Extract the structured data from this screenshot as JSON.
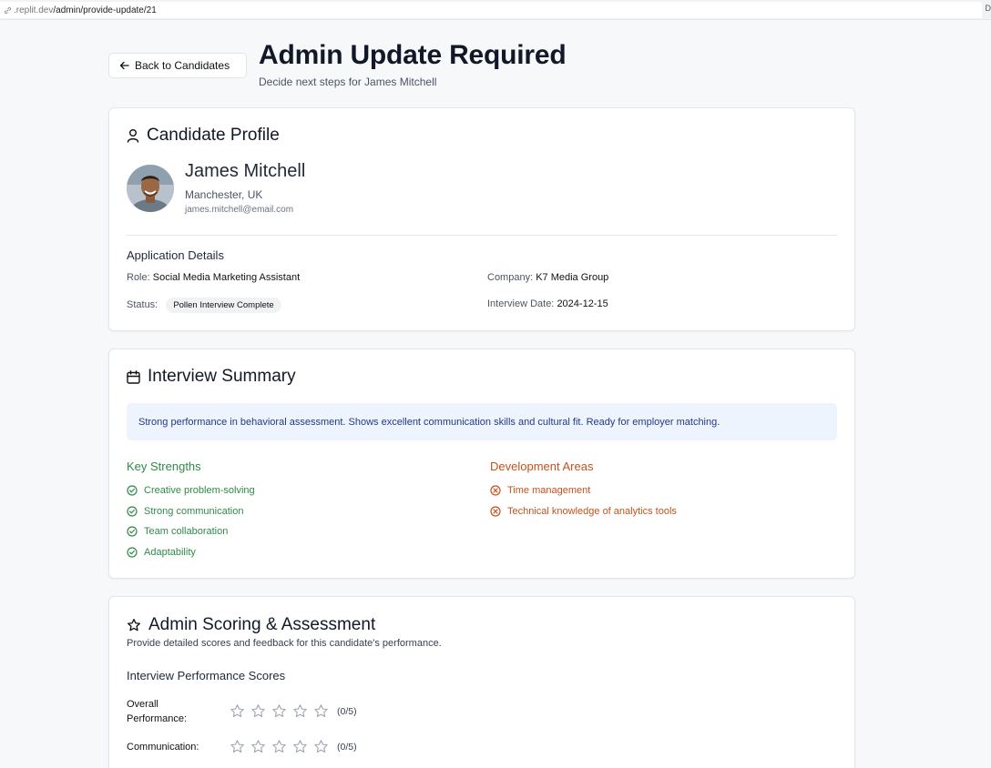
{
  "browser": {
    "url_host": ".replit.dev",
    "url_path": "/admin/provide-update/21",
    "edge_char": "D"
  },
  "header": {
    "back_label": "Back to Candidates",
    "title": "Admin Update Required",
    "subtitle": "Decide next steps for James Mitchell"
  },
  "profile": {
    "title": "Candidate Profile",
    "name": "James Mitchell",
    "location": "Manchester, UK",
    "email": "james.mitchell@email.com",
    "details_heading": "Application Details",
    "role_label": "Role:",
    "role": "Social Media Marketing Assistant",
    "company_label": "Company:",
    "company": "K7 Media Group",
    "status_label": "Status:",
    "status": "Pollen Interview Complete",
    "interview_date_label": "Interview Date:",
    "interview_date": "2024-12-15"
  },
  "summary": {
    "title": "Interview Summary",
    "text": "Strong performance in behavioral assessment. Shows excellent communication skills and cultural fit. Ready for employer matching.",
    "strengths_heading": "Key Strengths",
    "strengths": [
      "Creative problem-solving",
      "Strong communication",
      "Team collaboration",
      "Adaptability"
    ],
    "development_heading": "Development Areas",
    "development": [
      "Time management",
      "Technical knowledge of analytics tools"
    ]
  },
  "scoring": {
    "title": "Admin Scoring & Assessment",
    "subtitle": "Provide detailed scores and feedback for this candidate's performance.",
    "scores_heading": "Interview Performance Scores",
    "rows": [
      {
        "label": "Overall Performance:",
        "score": 0,
        "max": 5,
        "display": "(0/5)"
      },
      {
        "label": "Communication:",
        "score": 0,
        "max": 5,
        "display": "(0/5)"
      }
    ]
  },
  "colors": {
    "strength": "#2f8a49",
    "development": "#c4511c",
    "summary_bg": "#eef4fd",
    "summary_text": "#1e3a8a"
  }
}
